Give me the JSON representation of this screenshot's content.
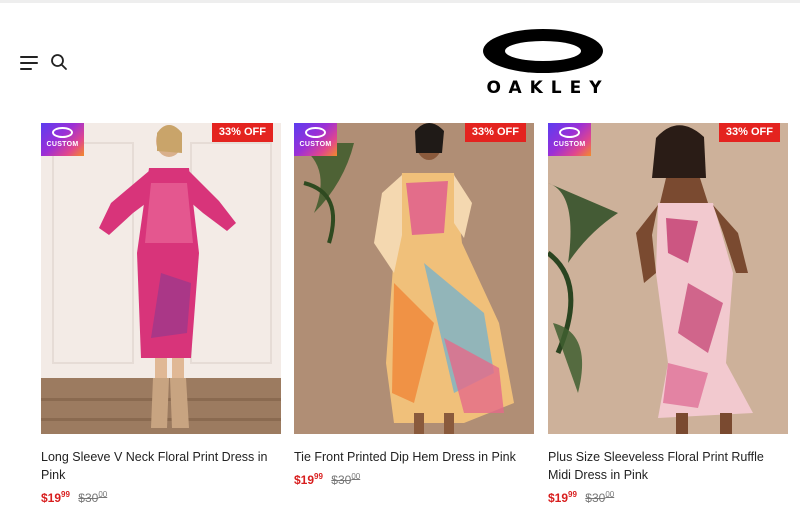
{
  "header": {
    "brand_name": "OAKLEY",
    "menu_icon": "hamburger-menu-icon",
    "search_icon": "search-icon"
  },
  "colors": {
    "sale_badge": "#e4231f",
    "price_now": "#d81e1e",
    "price_was": "#777777",
    "custom_badge_gradient": [
      "#5b3df0",
      "#9b2fd6",
      "#e0468e",
      "#f28c2a"
    ]
  },
  "products": [
    {
      "title": "Long Sleeve V Neck Floral Print Dress in Pink",
      "badge": "33% OFF",
      "custom_label": "CUSTOM",
      "price_now_main": "$19",
      "price_now_cents": "99",
      "price_was_main": "$30",
      "price_was_cents": "00"
    },
    {
      "title": "Tie Front Printed Dip Hem Dress in Pink",
      "badge": "33% OFF",
      "custom_label": "CUSTOM",
      "price_now_main": "$19",
      "price_now_cents": "99",
      "price_was_main": "$30",
      "price_was_cents": "00"
    },
    {
      "title": "Plus Size Sleeveless Floral Print Ruffle Midi Dress in Pink",
      "badge": "33% OFF",
      "custom_label": "CUSTOM",
      "price_now_main": "$19",
      "price_now_cents": "99",
      "price_was_main": "$30",
      "price_was_cents": "00"
    }
  ]
}
